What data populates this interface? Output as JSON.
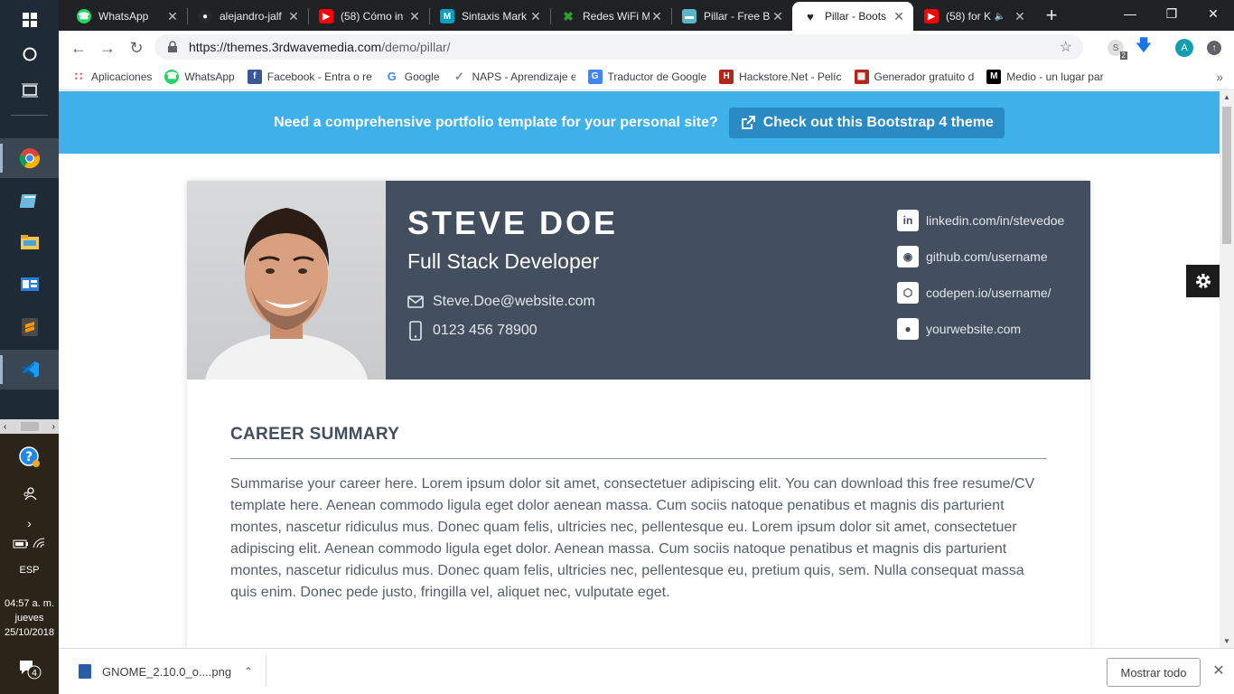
{
  "taskbar": {
    "language": "ESP",
    "time": "04:57 a. m.",
    "day": "jueves",
    "date": "25/10/2018",
    "notifications_count": "4"
  },
  "tabs": [
    {
      "title": "WhatsApp",
      "icon": "whatsapp-icon",
      "color": "#25d366"
    },
    {
      "title": "alejandro-jalf",
      "icon": "github-icon",
      "color": "#24292e"
    },
    {
      "title": "(58) Cómo in",
      "icon": "youtube-icon",
      "color": "#ff0000"
    },
    {
      "title": "Sintaxis Mark",
      "icon": "markdown-icon",
      "color": "#00a0c0"
    },
    {
      "title": "Redes WiFi M",
      "icon": "wifi-tool-icon",
      "color": "#2e9e2e"
    },
    {
      "title": "Pillar - Free B",
      "icon": "pillar-icon",
      "color": "#5fb3c9"
    },
    {
      "title": "Pillar - Boots",
      "icon": "heart-icon",
      "color": "#202124",
      "active": true
    },
    {
      "title": "(58) for K",
      "icon": "youtube-icon",
      "color": "#ff0000"
    }
  ],
  "toolbar": {
    "url_host": "https://themes.3rdwavemedia.com",
    "url_path": "/demo/pillar/",
    "profile_initial": "A",
    "ext_badge": "2"
  },
  "bookmarks": [
    {
      "label": "Aplicaciones",
      "icon": "apps-grid-icon",
      "color": "#e84335"
    },
    {
      "label": "WhatsApp",
      "icon": "whatsapp-icon",
      "color": "#25d366"
    },
    {
      "label": "Facebook - Entra o re",
      "icon": "facebook-icon",
      "color": "#3b5998"
    },
    {
      "label": "Google",
      "icon": "google-icon",
      "color": "#4285f4"
    },
    {
      "label": "NAPS - Aprendizaje e",
      "icon": "naps-icon",
      "color": "#7a8fa6"
    },
    {
      "label": "Traductor de Google",
      "icon": "translate-icon",
      "color": "#4285f4"
    },
    {
      "label": "Hackstore.Net - Pelíc",
      "icon": "hackstore-icon",
      "color": "#b0281c"
    },
    {
      "label": "Generador gratuito d",
      "icon": "generator-icon",
      "color": "#b0281c"
    },
    {
      "label": "Medio - un lugar par",
      "icon": "medium-icon",
      "color": "#000000"
    }
  ],
  "promo": {
    "text": "Need a comprehensive portfolio template for your personal site?",
    "button": "Check out this Bootstrap 4 theme"
  },
  "resume": {
    "name": "STEVE DOE",
    "title": "Full Stack Developer",
    "email": "Steve.Doe@website.com",
    "phone": "0123 456 78900",
    "social": [
      {
        "label": "linkedin.com/in/stevedoe",
        "icon": "linkedin-icon"
      },
      {
        "label": "github.com/username",
        "icon": "github-icon"
      },
      {
        "label": "codepen.io/username/",
        "icon": "codepen-icon"
      },
      {
        "label": "yourwebsite.com",
        "icon": "globe-icon"
      }
    ],
    "summary_title": "CAREER SUMMARY",
    "summary_text": "Summarise your career here. Lorem ipsum dolor sit amet, consectetuer adipiscing elit. You can download this free resume/CV template here. Aenean commodo ligula eget dolor aenean massa. Cum sociis natoque penatibus et magnis dis parturient montes, nascetur ridiculus mus. Donec quam felis, ultricies nec, pellentesque eu. Lorem ipsum dolor sit amet, consectetuer adipiscing elit. Aenean commodo ligula eget dolor. Aenean massa. Cum sociis natoque penatibus et magnis dis parturient montes, nascetur ridiculus mus. Donec quam felis, ultricies nec, pellentesque eu, pretium quis, sem. Nulla consequat massa quis enim. Donec pede justo, fringilla vel, aliquet nec, vulputate eget."
  },
  "download": {
    "filename": "GNOME_2.10.0_o....png",
    "show_all": "Mostrar todo"
  },
  "colors": {
    "promo_bg": "#3eb0ea",
    "header_bg": "#434e5e",
    "accent_button": "#2a8bc4"
  }
}
